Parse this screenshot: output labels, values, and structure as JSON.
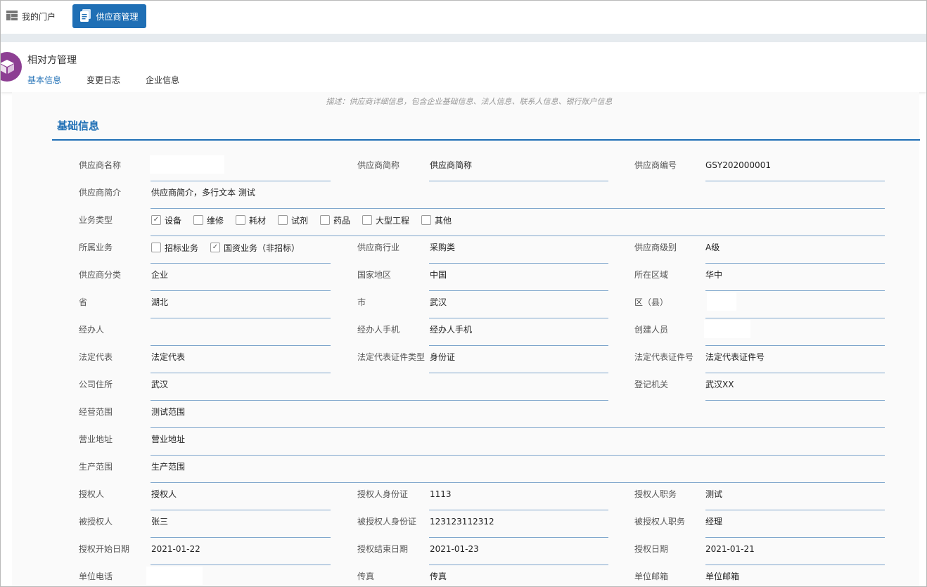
{
  "topbar": {
    "portal_label": "我的门户",
    "supplier_label": "供应商管理"
  },
  "header": {
    "title": "相对方管理",
    "tabs": [
      "基本信息",
      "变更日志",
      "企业信息"
    ]
  },
  "description": "描述：供应商详细信息，包含企业基础信息、法人信息、联系人信息、银行账户信息",
  "section_title": "基础信息",
  "fields": {
    "supplier_name": {
      "label": "供应商名称",
      "value": ""
    },
    "supplier_short": {
      "label": "供应商简称",
      "value": "供应商简称"
    },
    "supplier_code": {
      "label": "供应商编号",
      "value": "GSY202000001"
    },
    "supplier_intro": {
      "label": "供应商简介",
      "value": "供应商简介，多行文本  测试"
    },
    "business_type": {
      "label": "业务类型"
    },
    "belong_business": {
      "label": "所属业务"
    },
    "industry": {
      "label": "供应商行业",
      "value": "采购类"
    },
    "level": {
      "label": "供应商级别",
      "value": "A级"
    },
    "category": {
      "label": "供应商分类",
      "value": "企业"
    },
    "country": {
      "label": "国家地区",
      "value": "中国"
    },
    "region": {
      "label": "所在区域",
      "value": "华中"
    },
    "province": {
      "label": "省",
      "value": "湖北"
    },
    "city": {
      "label": "市",
      "value": "武汉"
    },
    "district": {
      "label": "区（县）",
      "value": ""
    },
    "handler": {
      "label": "经办人",
      "value": ""
    },
    "handler_phone": {
      "label": "经办人手机",
      "value": "经办人手机"
    },
    "creator": {
      "label": "创建人员",
      "value": ""
    },
    "legal_rep": {
      "label": "法定代表",
      "value": "法定代表"
    },
    "legal_id_type": {
      "label": "法定代表证件类型",
      "value": "身份证"
    },
    "legal_id_no": {
      "label": "法定代表证件号",
      "value": "法定代表证件号"
    },
    "address": {
      "label": "公司住所",
      "value": "武汉"
    },
    "reg_authority": {
      "label": "登记机关",
      "value": "武汉XX"
    },
    "scope": {
      "label": "经营范围",
      "value": "测试范围"
    },
    "biz_address": {
      "label": "营业地址",
      "value": "营业地址"
    },
    "prod_scope": {
      "label": "生产范围",
      "value": "生产范围"
    },
    "grantor": {
      "label": "授权人",
      "value": "授权人"
    },
    "grantor_id": {
      "label": "授权人身份证",
      "value": "1113"
    },
    "grantor_title": {
      "label": "授权人职务",
      "value": "测试"
    },
    "grantee": {
      "label": "被授权人",
      "value": "张三"
    },
    "grantee_id": {
      "label": "被授权人身份证",
      "value": "123123112312"
    },
    "grantee_title": {
      "label": "被授权人职务",
      "value": "经理"
    },
    "auth_start": {
      "label": "授权开始日期",
      "value": "2021-01-22"
    },
    "auth_end": {
      "label": "授权结束日期",
      "value": "2021-01-23"
    },
    "auth_date": {
      "label": "授权日期",
      "value": "2021-01-21"
    },
    "phone": {
      "label": "单位电话",
      "value": ""
    },
    "fax": {
      "label": "传真",
      "value": "传真"
    },
    "email": {
      "label": "单位邮箱",
      "value": "单位邮箱"
    }
  },
  "business_types": [
    {
      "label": "设备",
      "checked": true
    },
    {
      "label": "维修",
      "checked": false
    },
    {
      "label": "耗材",
      "checked": false
    },
    {
      "label": "试剂",
      "checked": false
    },
    {
      "label": "药品",
      "checked": false
    },
    {
      "label": "大型工程",
      "checked": false
    },
    {
      "label": "其他",
      "checked": false
    }
  ],
  "belong_options": [
    {
      "label": "招标业务",
      "checked": false
    },
    {
      "label": "国资业务（非招标）",
      "checked": true
    }
  ],
  "colors": {
    "accent": "#1f6fb5",
    "logo": "#8d3f93",
    "underline": "#7fa6cc"
  }
}
